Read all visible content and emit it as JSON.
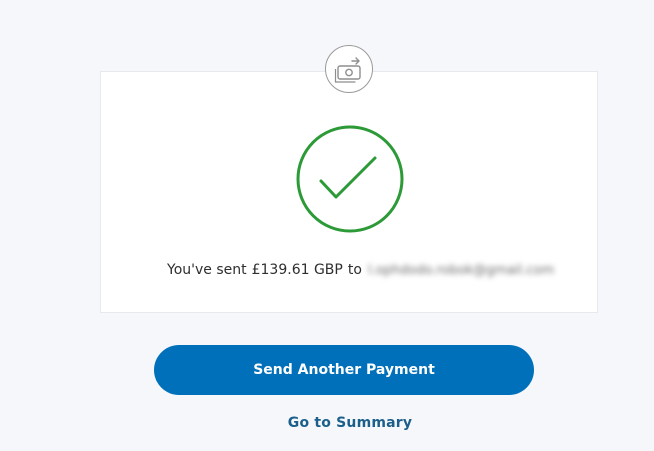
{
  "confirmation": {
    "message_prefix": "You've sent",
    "amount": "£139.61 GBP",
    "message_to": "to",
    "recipient_email": "l.ophdodo.robok@gmail.com"
  },
  "actions": {
    "send_another_label": "Send Another Payment",
    "go_to_summary_label": "Go to Summary"
  },
  "icons": {
    "top_badge": "money-transfer-icon",
    "success": "checkmark-circle-icon"
  },
  "colors": {
    "primary_button": "#0070ba",
    "success_green": "#2d9a38",
    "link": "#1b5f8a"
  }
}
